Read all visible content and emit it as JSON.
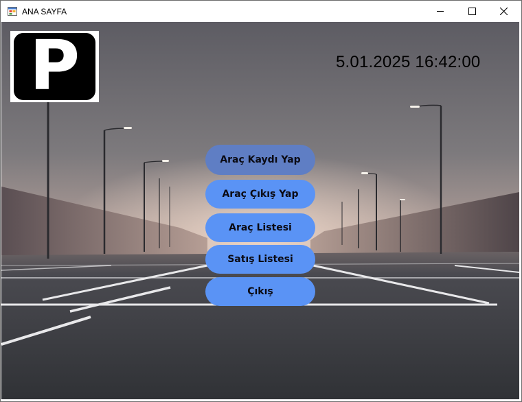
{
  "window": {
    "title": "ANA SAYFA"
  },
  "logo": {
    "letter": "P"
  },
  "clock": {
    "text": "5.01.2025 16:42:00"
  },
  "menu": {
    "buttons": [
      {
        "label": "Araç Kaydı Yap",
        "state": "hover"
      },
      {
        "label": "Araç Çıkış Yap"
      },
      {
        "label": "Araç Listesi"
      },
      {
        "label": "Satış Listesi"
      },
      {
        "label": "Çıkış"
      }
    ]
  },
  "colors": {
    "button": "#5a93f5",
    "button_hover": "#5f7ec4",
    "sky": "#6e6c70",
    "asphalt": "#3b3c40"
  },
  "icons": [
    "app-form-icon",
    "minimize-icon",
    "maximize-icon",
    "close-icon"
  ]
}
